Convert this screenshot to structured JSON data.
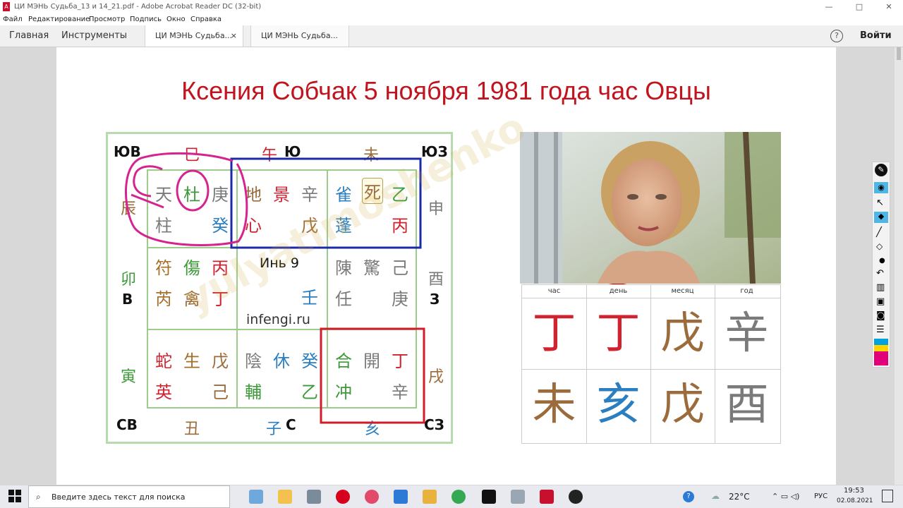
{
  "window": {
    "title": "ЦИ МЭНЬ  Судьба_13 и 14_21.pdf - Adobe Acrobat Reader DC (32-bit)",
    "pdf_icon": "pdf-icon"
  },
  "menu": [
    "Файл",
    "Редактирование",
    "Просмотр",
    "Подпись",
    "Окно",
    "Справка"
  ],
  "tabs": {
    "home": "Главная",
    "tools": "Инструменты",
    "doc1": "ЦИ МЭНЬ  Судьба...",
    "doc2": "ЦИ МЭНЬ  Судьба...",
    "close": "×",
    "help": "?",
    "login": "Войти"
  },
  "slide": {
    "title": "Ксения Собчак 5 ноября 1981 года час Овцы",
    "chart": {
      "directions": {
        "se": "ЮВ",
        "s": "Ю",
        "sw": "ЮЗ",
        "e": "В",
        "w": "З",
        "ne": "СВ",
        "n": "С",
        "nw": "СЗ"
      },
      "branches": {
        "si": "巳",
        "wu": "午",
        "wei": "未",
        "chen": "辰",
        "shen": "申",
        "mao": "卯",
        "you": "酉",
        "yin": "寅",
        "xu": "戌",
        "chou": "丑",
        "zi": "子",
        "hai": "亥"
      },
      "palaces": {
        "p1": [
          "天",
          "杜",
          "庚",
          "柱",
          "癸"
        ],
        "p2": [
          "地",
          "景",
          "辛",
          "心",
          "戊"
        ],
        "p3": [
          "雀",
          "死",
          "乙",
          "蓬",
          "丙"
        ],
        "p4": [
          "符",
          "傷",
          "丙",
          "芮",
          "禽",
          "丁"
        ],
        "p5_label": "Инь 9",
        "p5_char": "壬",
        "p5_site": "infengi.ru",
        "p6": [
          "陳",
          "驚",
          "己",
          "任",
          "庚"
        ],
        "p7": [
          "蛇",
          "生",
          "戊",
          "英",
          "己"
        ],
        "p8": [
          "陰",
          "休",
          "癸",
          "輔",
          "乙"
        ],
        "p9": [
          "合",
          "開",
          "丁",
          "冲",
          "辛"
        ]
      }
    },
    "pillars": {
      "headers": [
        "час",
        "день",
        "месяц",
        "год"
      ],
      "stems": [
        "丁",
        "丁",
        "戊",
        "辛"
      ],
      "branches": [
        "未",
        "亥",
        "戊",
        "酉"
      ]
    },
    "watermark": "yulyatimoshenko"
  },
  "toolbar_icons": [
    "pen-icon",
    "eye-icon",
    "pointer-icon",
    "eraser-icon",
    "pencil-icon",
    "stamp-icon",
    "dot-icon",
    "undo-icon",
    "trash-icon",
    "save-icon",
    "camera-icon",
    "notes-icon",
    "color-palette-icon"
  ],
  "taskbar": {
    "search_placeholder": "Введите здесь текст для поиска",
    "weather": "22°C",
    "lang": "РУС",
    "time": "19:53",
    "date": "02.08.2021"
  },
  "colors": {
    "title_red": "#c0151e",
    "grid_green": "#9bcc8a",
    "pen_magenta": "#d6248f",
    "box_blue": "#1d2aa8",
    "box_red": "#d31c2a"
  }
}
